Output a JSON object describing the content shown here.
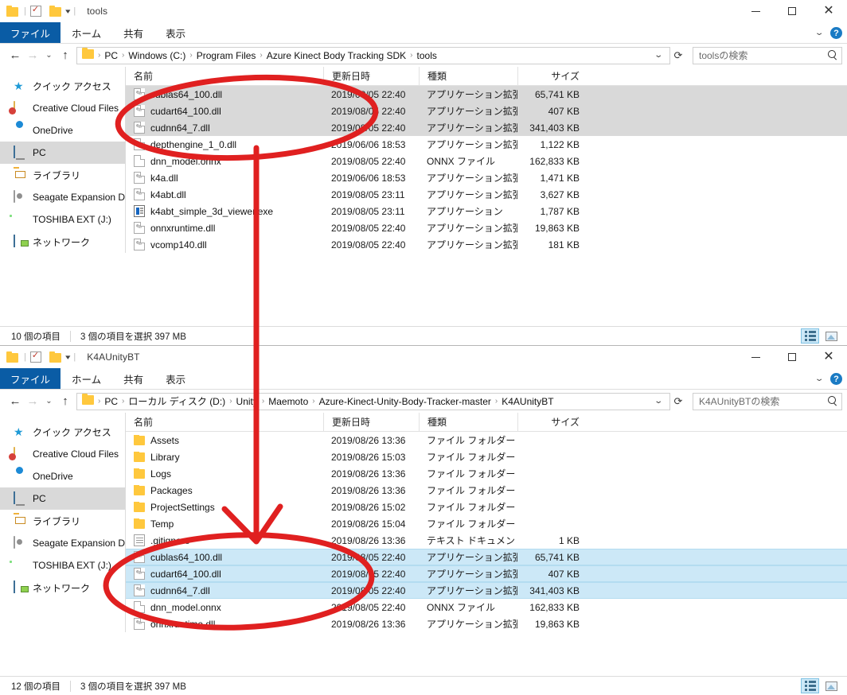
{
  "windows": [
    {
      "title": "tools",
      "ribbon_tabs": [
        "ファイル",
        "ホーム",
        "共有",
        "表示"
      ],
      "breadcrumbs": [
        "PC",
        "Windows (C:)",
        "Program Files",
        "Azure Kinect Body Tracking SDK",
        "tools"
      ],
      "search_placeholder": "toolsの検索",
      "nav_items": [
        {
          "label": "クイック アクセス",
          "icon": "star-icon",
          "selected": false
        },
        {
          "label": "Creative Cloud Files",
          "icon": "creative-cloud-icon",
          "selected": false
        },
        {
          "label": "OneDrive",
          "icon": "cloud-icon",
          "selected": false
        },
        {
          "label": "PC",
          "icon": "pc-icon",
          "selected": true
        },
        {
          "label": "ライブラリ",
          "icon": "library-icon",
          "selected": false
        },
        {
          "label": "Seagate Expansion Dr",
          "icon": "drive-icon",
          "selected": false
        },
        {
          "label": "TOSHIBA EXT (J:)",
          "icon": "external-drive-icon",
          "selected": false
        },
        {
          "label": "ネットワーク",
          "icon": "network-icon",
          "selected": false
        }
      ],
      "columns": [
        "名前",
        "更新日時",
        "種類",
        "サイズ"
      ],
      "files": [
        {
          "name": "cublas64_100.dll",
          "date": "2019/08/05 22:40",
          "type": "アプリケーション拡張",
          "size": "65,741 KB",
          "icon": "dll",
          "selected": true
        },
        {
          "name": "cudart64_100.dll",
          "date": "2019/08/05 22:40",
          "type": "アプリケーション拡張",
          "size": "407 KB",
          "icon": "dll",
          "selected": true
        },
        {
          "name": "cudnn64_7.dll",
          "date": "2019/08/05 22:40",
          "type": "アプリケーション拡張",
          "size": "341,403 KB",
          "icon": "dll",
          "selected": true
        },
        {
          "name": "depthengine_1_0.dll",
          "date": "2019/06/06 18:53",
          "type": "アプリケーション拡張",
          "size": "1,122 KB",
          "icon": "dll",
          "selected": false
        },
        {
          "name": "dnn_model.onnx",
          "date": "2019/08/05 22:40",
          "type": "ONNX ファイル",
          "size": "162,833 KB",
          "icon": "doc",
          "selected": false
        },
        {
          "name": "k4a.dll",
          "date": "2019/06/06 18:53",
          "type": "アプリケーション拡張",
          "size": "1,471 KB",
          "icon": "dll",
          "selected": false
        },
        {
          "name": "k4abt.dll",
          "date": "2019/08/05 23:11",
          "type": "アプリケーション拡張",
          "size": "3,627 KB",
          "icon": "dll",
          "selected": false
        },
        {
          "name": "k4abt_simple_3d_viewer.exe",
          "date": "2019/08/05 23:11",
          "type": "アプリケーション",
          "size": "1,787 KB",
          "icon": "exe",
          "selected": false
        },
        {
          "name": "onnxruntime.dll",
          "date": "2019/08/05 22:40",
          "type": "アプリケーション拡張",
          "size": "19,863 KB",
          "icon": "dll",
          "selected": false
        },
        {
          "name": "vcomp140.dll",
          "date": "2019/08/05 22:40",
          "type": "アプリケーション拡張",
          "size": "181 KB",
          "icon": "dll",
          "selected": false
        }
      ],
      "status_count": "10 個の項目",
      "status_selection": "3 個の項目を選択  397 MB"
    },
    {
      "title": "K4AUnityBT",
      "ribbon_tabs": [
        "ファイル",
        "ホーム",
        "共有",
        "表示"
      ],
      "breadcrumbs": [
        "PC",
        "ローカル ディスク (D:)",
        "Unity",
        "Maemoto",
        "Azure-Kinect-Unity-Body-Tracker-master",
        "K4AUnityBT"
      ],
      "search_placeholder": "K4AUnityBTの検索",
      "nav_items": [
        {
          "label": "クイック アクセス",
          "icon": "star-icon",
          "selected": false
        },
        {
          "label": "Creative Cloud Files",
          "icon": "creative-cloud-icon",
          "selected": false
        },
        {
          "label": "OneDrive",
          "icon": "cloud-icon",
          "selected": false
        },
        {
          "label": "PC",
          "icon": "pc-icon",
          "selected": true
        },
        {
          "label": "ライブラリ",
          "icon": "library-icon",
          "selected": false
        },
        {
          "label": "Seagate Expansion Dr",
          "icon": "drive-icon",
          "selected": false
        },
        {
          "label": "TOSHIBA EXT (J:)",
          "icon": "external-drive-icon",
          "selected": false
        },
        {
          "label": "ネットワーク",
          "icon": "network-icon",
          "selected": false
        }
      ],
      "columns": [
        "名前",
        "更新日時",
        "種類",
        "サイズ"
      ],
      "files": [
        {
          "name": "Assets",
          "date": "2019/08/26 13:36",
          "type": "ファイル フォルダー",
          "size": "",
          "icon": "folder",
          "selected": false
        },
        {
          "name": "Library",
          "date": "2019/08/26 15:03",
          "type": "ファイル フォルダー",
          "size": "",
          "icon": "folder",
          "selected": false
        },
        {
          "name": "Logs",
          "date": "2019/08/26 13:36",
          "type": "ファイル フォルダー",
          "size": "",
          "icon": "folder",
          "selected": false
        },
        {
          "name": "Packages",
          "date": "2019/08/26 13:36",
          "type": "ファイル フォルダー",
          "size": "",
          "icon": "folder",
          "selected": false
        },
        {
          "name": "ProjectSettings",
          "date": "2019/08/26 15:02",
          "type": "ファイル フォルダー",
          "size": "",
          "icon": "folder",
          "selected": false
        },
        {
          "name": "Temp",
          "date": "2019/08/26 15:04",
          "type": "ファイル フォルダー",
          "size": "",
          "icon": "folder",
          "selected": false
        },
        {
          "name": ".gitignore",
          "date": "2019/08/26 13:36",
          "type": "テキスト ドキュメント",
          "size": "1 KB",
          "icon": "txt",
          "selected": false
        },
        {
          "name": "cublas64_100.dll",
          "date": "2019/08/05 22:40",
          "type": "アプリケーション拡張",
          "size": "65,741 KB",
          "icon": "dll",
          "selected": true
        },
        {
          "name": "cudart64_100.dll",
          "date": "2019/08/05 22:40",
          "type": "アプリケーション拡張",
          "size": "407 KB",
          "icon": "dll",
          "selected": true
        },
        {
          "name": "cudnn64_7.dll",
          "date": "2019/08/05 22:40",
          "type": "アプリケーション拡張",
          "size": "341,403 KB",
          "icon": "dll",
          "selected": true
        },
        {
          "name": "dnn_model.onnx",
          "date": "2019/08/05 22:40",
          "type": "ONNX ファイル",
          "size": "162,833 KB",
          "icon": "doc",
          "selected": false
        },
        {
          "name": "onnxruntime.dll",
          "date": "2019/08/26 13:36",
          "type": "アプリケーション拡張",
          "size": "19,863 KB",
          "icon": "dll",
          "selected": false
        }
      ],
      "status_count": "12 個の項目",
      "status_selection": "3 個の項目を選択  397 MB"
    }
  ],
  "annotation": {
    "color": "#e02020",
    "shapes": [
      "ellipse-top",
      "ellipse-bottom",
      "arrow-down"
    ]
  }
}
